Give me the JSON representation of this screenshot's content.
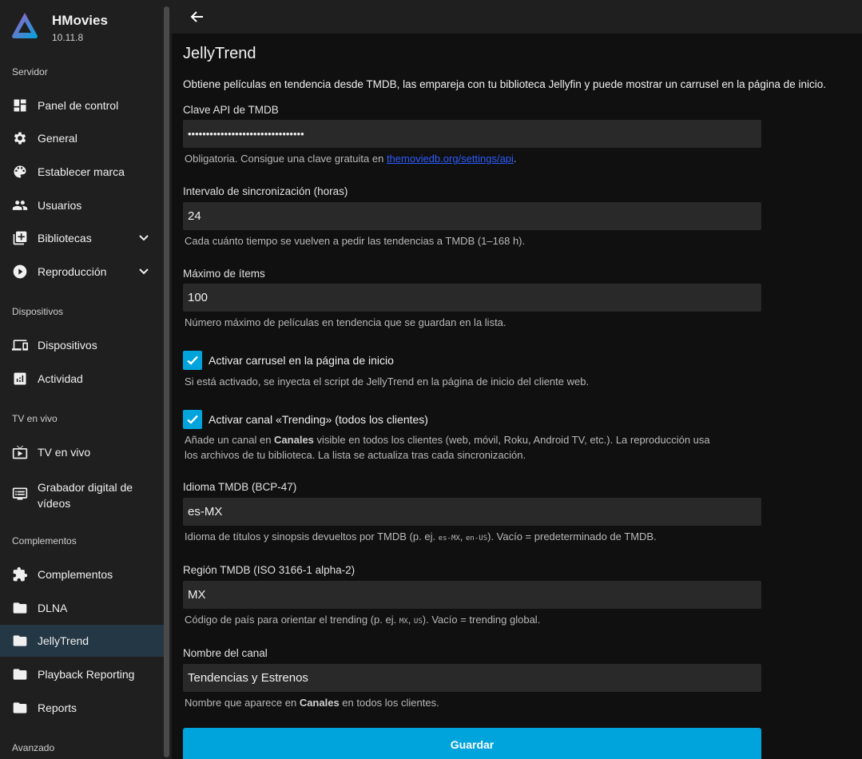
{
  "app": {
    "name": "HMovies",
    "version": "10.11.8"
  },
  "sidebar": {
    "sections": {
      "servidor": "Servidor",
      "dispositivos": "Dispositivos",
      "tv": "TV en vivo",
      "complementos": "Complementos",
      "avanzado": "Avanzado"
    },
    "items": [
      {
        "label": "Panel de control",
        "icon": "dashboard-icon"
      },
      {
        "label": "General",
        "icon": "gear-icon"
      },
      {
        "label": "Establecer marca",
        "icon": "palette-icon"
      },
      {
        "label": "Usuarios",
        "icon": "users-icon"
      },
      {
        "label": "Bibliotecas",
        "icon": "library-add-icon",
        "expandable": true
      },
      {
        "label": "Reproducción",
        "icon": "play-circle-icon",
        "expandable": true
      },
      {
        "label": "Dispositivos",
        "icon": "devices-icon"
      },
      {
        "label": "Actividad",
        "icon": "analytics-icon"
      },
      {
        "label": "TV en vivo",
        "icon": "live-tv-icon"
      },
      {
        "label": "Grabador digital de vídeos",
        "icon": "dvr-icon"
      },
      {
        "label": "Complementos",
        "icon": "puzzle-icon"
      },
      {
        "label": "DLNA",
        "icon": "folder-icon"
      },
      {
        "label": "JellyTrend",
        "icon": "folder-icon",
        "active": true
      },
      {
        "label": "Playback Reporting",
        "icon": "folder-icon"
      },
      {
        "label": "Reports",
        "icon": "folder-icon"
      }
    ]
  },
  "page": {
    "title": "JellyTrend",
    "description": "Obtiene películas en tendencia desde TMDB, las empareja con tu biblioteca Jellyfin y puede mostrar un carrusel en la página de inicio."
  },
  "form": {
    "api_key": {
      "label": "Clave API de TMDB",
      "value": "••••••••••••••••••••••••••••••••",
      "help_prefix": "Obligatoria. Consigue una clave gratuita en ",
      "help_link": "themoviedb.org/settings/api",
      "help_suffix": "."
    },
    "interval": {
      "label": "Intervalo de sincronización (horas)",
      "value": "24",
      "help": "Cada cuánto tiempo se vuelven a pedir las tendencias a TMDB (1–168 h)."
    },
    "max_items": {
      "label": "Máximo de ítems",
      "value": "100",
      "help": "Número máximo de películas en tendencia que se guardan en la lista."
    },
    "carousel": {
      "label": "Activar carrusel en la página de inicio",
      "checked": true,
      "help": "Si está activado, se inyecta el script de JellyTrend en la página de inicio del cliente web."
    },
    "channel": {
      "label": "Activar canal «Trending» (todos los clientes)",
      "checked": true,
      "help1_prefix": "Añade un canal en ",
      "help1_bold": "Canales",
      "help1_suffix": " visible en todos los clientes (web, móvil, Roku, Android TV, etc.). La reproducción usa",
      "help2": "los archivos de tu biblioteca. La lista se actualiza tras cada sincronización."
    },
    "language": {
      "label": "Idioma TMDB (BCP-47)",
      "value": "es-MX",
      "help_a": "Idioma de títulos y sinopsis devueltos por TMDB (p. ej. ",
      "code1": "es-MX",
      "sep": ", ",
      "code2": "en-US",
      "help_b": "). Vacío = predeterminado de TMDB."
    },
    "region": {
      "label": "Región TMDB (ISO 3166-1 alpha-2)",
      "value": "MX",
      "help_a": "Código de país para orientar el trending (p. ej. ",
      "code1": "MX",
      "sep": ", ",
      "code2": "US",
      "help_b": "). Vacío = trending global."
    },
    "channel_name": {
      "label": "Nombre del canal",
      "value": "Tendencias y Estrenos",
      "help_prefix": "Nombre que aparece en ",
      "help_bold": "Canales",
      "help_suffix": " en todos los clientes."
    },
    "save_label": "Guardar"
  },
  "colors": {
    "accent": "#00a4dc",
    "active_item": "#233744",
    "sidebar_bg": "#1f1f1f",
    "main_bg": "#101010"
  }
}
